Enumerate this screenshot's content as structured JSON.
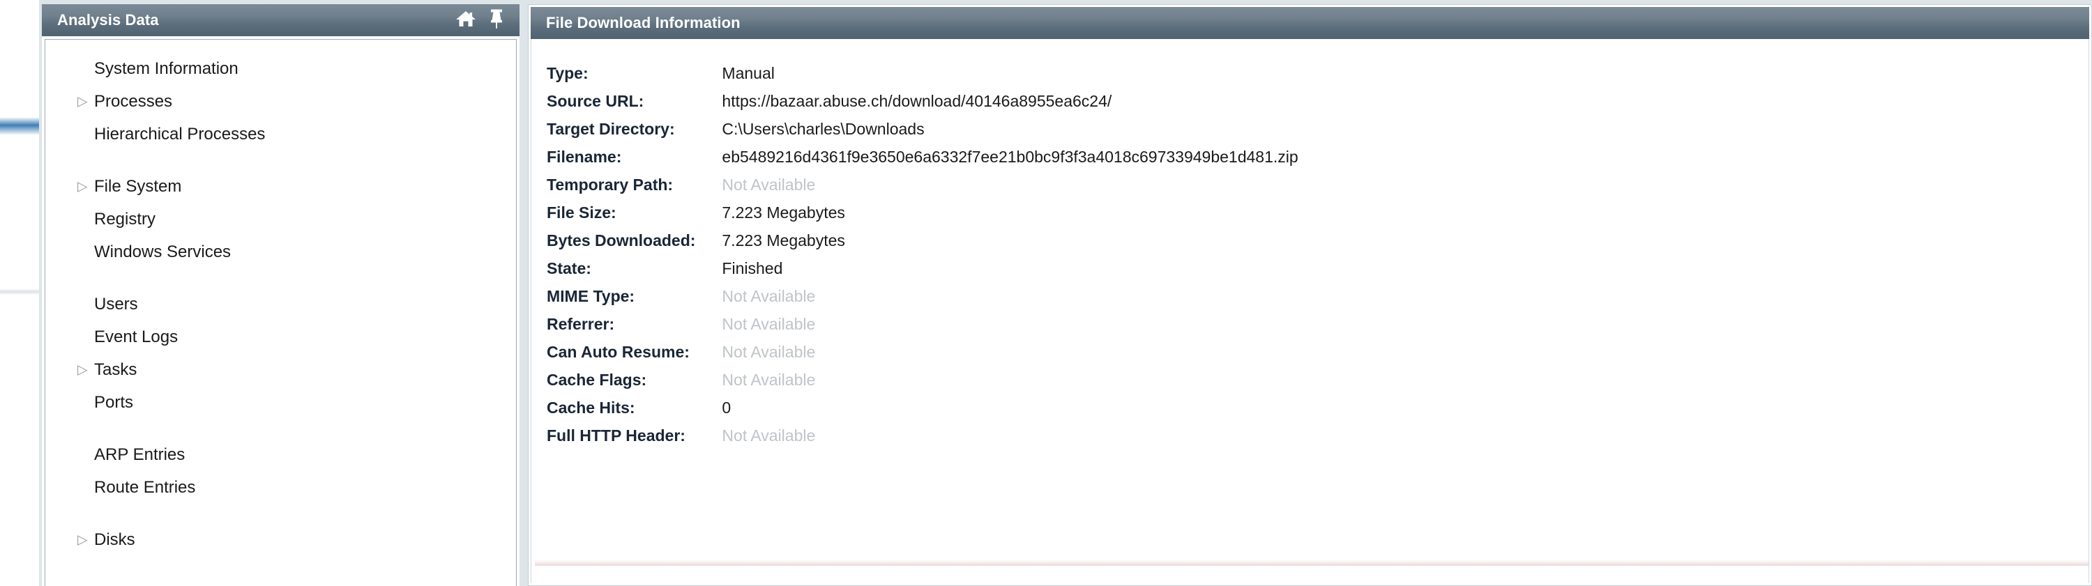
{
  "left_panel": {
    "title": "Analysis Data",
    "tools": [
      {
        "name": "home-icon",
        "label": "Home"
      },
      {
        "name": "pin-icon",
        "label": "Pin"
      }
    ],
    "tree": [
      {
        "label": "System Information",
        "expandable": false
      },
      {
        "label": "Processes",
        "expandable": true
      },
      {
        "label": "Hierarchical Processes",
        "expandable": false
      },
      {
        "spacer": true
      },
      {
        "label": "File System",
        "expandable": true
      },
      {
        "label": "Registry",
        "expandable": false
      },
      {
        "label": "Windows Services",
        "expandable": false
      },
      {
        "spacer": true
      },
      {
        "label": "Users",
        "expandable": false
      },
      {
        "label": "Event Logs",
        "expandable": false
      },
      {
        "label": "Tasks",
        "expandable": true
      },
      {
        "label": "Ports",
        "expandable": false
      },
      {
        "spacer": true
      },
      {
        "label": "ARP Entries",
        "expandable": false
      },
      {
        "label": "Route Entries",
        "expandable": false
      },
      {
        "spacer": true
      },
      {
        "label": "Disks",
        "expandable": true
      }
    ]
  },
  "right_panel": {
    "title": "File Download Information",
    "rows": [
      {
        "label": "Type:",
        "value": "Manual",
        "available": true
      },
      {
        "label": "Source URL:",
        "value": "https://bazaar.abuse.ch/download/40146a8955ea6c24/",
        "available": true
      },
      {
        "label": "Target Directory:",
        "value": "C:\\Users\\charles\\Downloads",
        "available": true
      },
      {
        "label": "Filename:",
        "value": "eb5489216d4361f9e3650e6a6332f7ee21b0bc9f3f3a4018c69733949be1d481.zip",
        "available": true
      },
      {
        "label": "Temporary Path:",
        "value": "Not Available",
        "available": false
      },
      {
        "label": "File Size:",
        "value": "7.223 Megabytes",
        "available": true
      },
      {
        "label": "Bytes Downloaded:",
        "value": "7.223 Megabytes",
        "available": true
      },
      {
        "label": "State:",
        "value": "Finished",
        "available": true
      },
      {
        "label": "MIME Type:",
        "value": "Not Available",
        "available": false
      },
      {
        "label": "Referrer:",
        "value": "Not Available",
        "available": false
      },
      {
        "label": "Can Auto Resume:",
        "value": "Not Available",
        "available": false
      },
      {
        "label": "Cache Flags:",
        "value": "Not Available",
        "available": false
      },
      {
        "label": "Cache Hits:",
        "value": "0",
        "available": true
      },
      {
        "label": "Full HTTP Header:",
        "value": "Not Available",
        "available": false
      }
    ]
  },
  "colors": {
    "header_gradient_top": "#7c8b97",
    "header_gradient_bottom": "#4f6270",
    "label_text": "#1a2636",
    "unavailable_text": "#bfc4c7",
    "accent_bar": "#9c2437",
    "desktop": "#06223f",
    "window_chrome": "#dde5e9"
  }
}
